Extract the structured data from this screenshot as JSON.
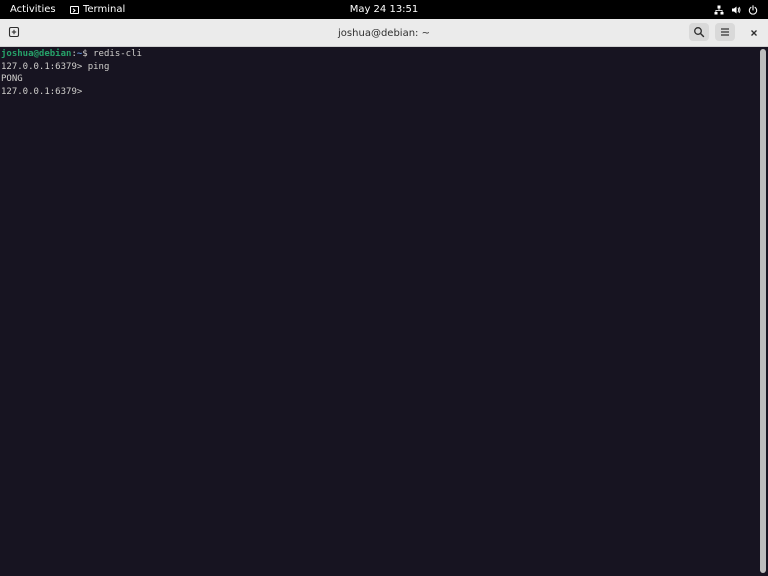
{
  "topbar": {
    "activities_label": "Activities",
    "app_name": "Terminal",
    "app_icon": "terminal-icon",
    "clock": "May 24  13:51",
    "tray_icons": [
      "network-icon",
      "volume-icon",
      "power-icon"
    ]
  },
  "window": {
    "title": "joshua@debian: ~",
    "buttons": [
      "new-tab-icon",
      "search-icon",
      "hamburger-menu-icon",
      "close-icon"
    ]
  },
  "terminal": {
    "prompt_user": "joshua@debian",
    "prompt_sep": ":",
    "prompt_path": "~",
    "prompt_symbol": "$ ",
    "command": "redis-cli",
    "redis_prompt_1": "127.0.0.1:6379> ",
    "redis_cmd_1": "ping",
    "output_1": "PONG",
    "redis_prompt_2": "127.0.0.1:6379> "
  },
  "colors": {
    "terminal_bg": "#171421",
    "terminal_fg": "#d0cfcc",
    "prompt_user": "#26a269",
    "prompt_path": "#5e8ad0",
    "headerbar_bg": "#ebebeb",
    "topbar_bg": "#000000"
  }
}
